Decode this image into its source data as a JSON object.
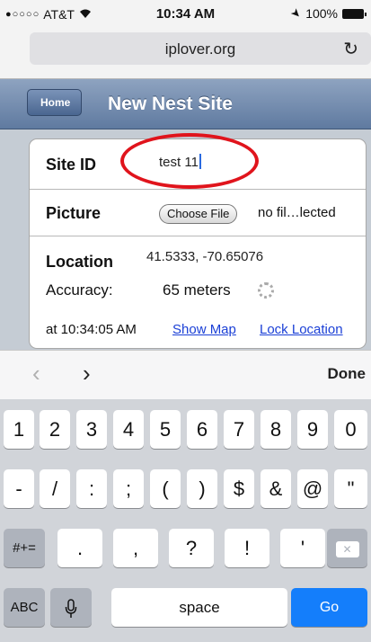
{
  "status_bar": {
    "signal_dots": "●○○○○",
    "carrier": "AT&T",
    "time": "10:34 AM",
    "battery": "100%"
  },
  "browser": {
    "url": "iplover.org",
    "reload_icon": "reload-icon"
  },
  "nav": {
    "back_label": "Home",
    "title": "New Nest Site"
  },
  "form": {
    "site_id": {
      "label": "Site ID",
      "value": "test 11"
    },
    "picture": {
      "label": "Picture",
      "button": "Choose File",
      "status": "no fil…lected"
    },
    "location": {
      "label": "Location",
      "coords": "41.5333, -70.65076",
      "accuracy_label": "Accuracy:",
      "accuracy_value": "65 meters",
      "time": "at 10:34:05 AM",
      "show_map": "Show Map",
      "lock_location": "Lock Location"
    }
  },
  "accessory": {
    "prev": "‹",
    "next": "›",
    "done": "Done"
  },
  "keyboard": {
    "row1": [
      "1",
      "2",
      "3",
      "4",
      "5",
      "6",
      "7",
      "8",
      "9",
      "0"
    ],
    "row2": [
      "-",
      "/",
      ":",
      ";",
      "(",
      ")",
      "$",
      "&",
      "@",
      "\""
    ],
    "row3_left": "#+=",
    "row3": [
      ".",
      ",",
      "?",
      "!",
      "'"
    ],
    "abc": "ABC",
    "space": "space",
    "go": "Go"
  },
  "colors": {
    "nav_bar": "#6f88ac",
    "go_key": "#147efb",
    "link": "#1a3fd6",
    "highlight_circle": "#e0141c"
  }
}
